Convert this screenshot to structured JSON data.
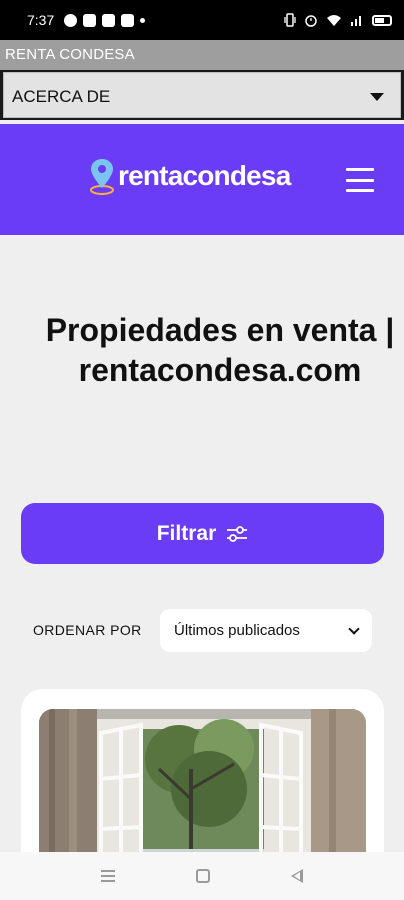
{
  "status_bar": {
    "time": "7:37",
    "left_icons": [
      "whatsapp-icon",
      "document-icon",
      "gmail-icon",
      "youtube-icon",
      "dot-icon"
    ],
    "right_icons": [
      "vibrate-icon",
      "alarm-icon",
      "wifi-icon",
      "signal-icon",
      "battery-icon"
    ]
  },
  "app": {
    "title": "RENTA CONDESA",
    "select_value": "ACERCA DE"
  },
  "site_header": {
    "logo_text": "rentacondesa",
    "logo_icon": "location-pin-icon",
    "menu_icon": "hamburger-menu-icon"
  },
  "main": {
    "title": "Propiedades en venta | rentacondesa.com",
    "filter_label": "Filtrar",
    "filter_icon": "sliders-icon",
    "sort_label": "ORDENAR POR",
    "sort_value": "Últimos publicados"
  },
  "card": {
    "image_icon": "window-view-photo"
  },
  "nav_bar": {
    "icons": [
      "recent-apps-icon",
      "home-icon",
      "back-icon"
    ]
  },
  "colors": {
    "brand": "#6b3cf5",
    "background": "#efefef",
    "app_bar": "#9e9e9e"
  }
}
